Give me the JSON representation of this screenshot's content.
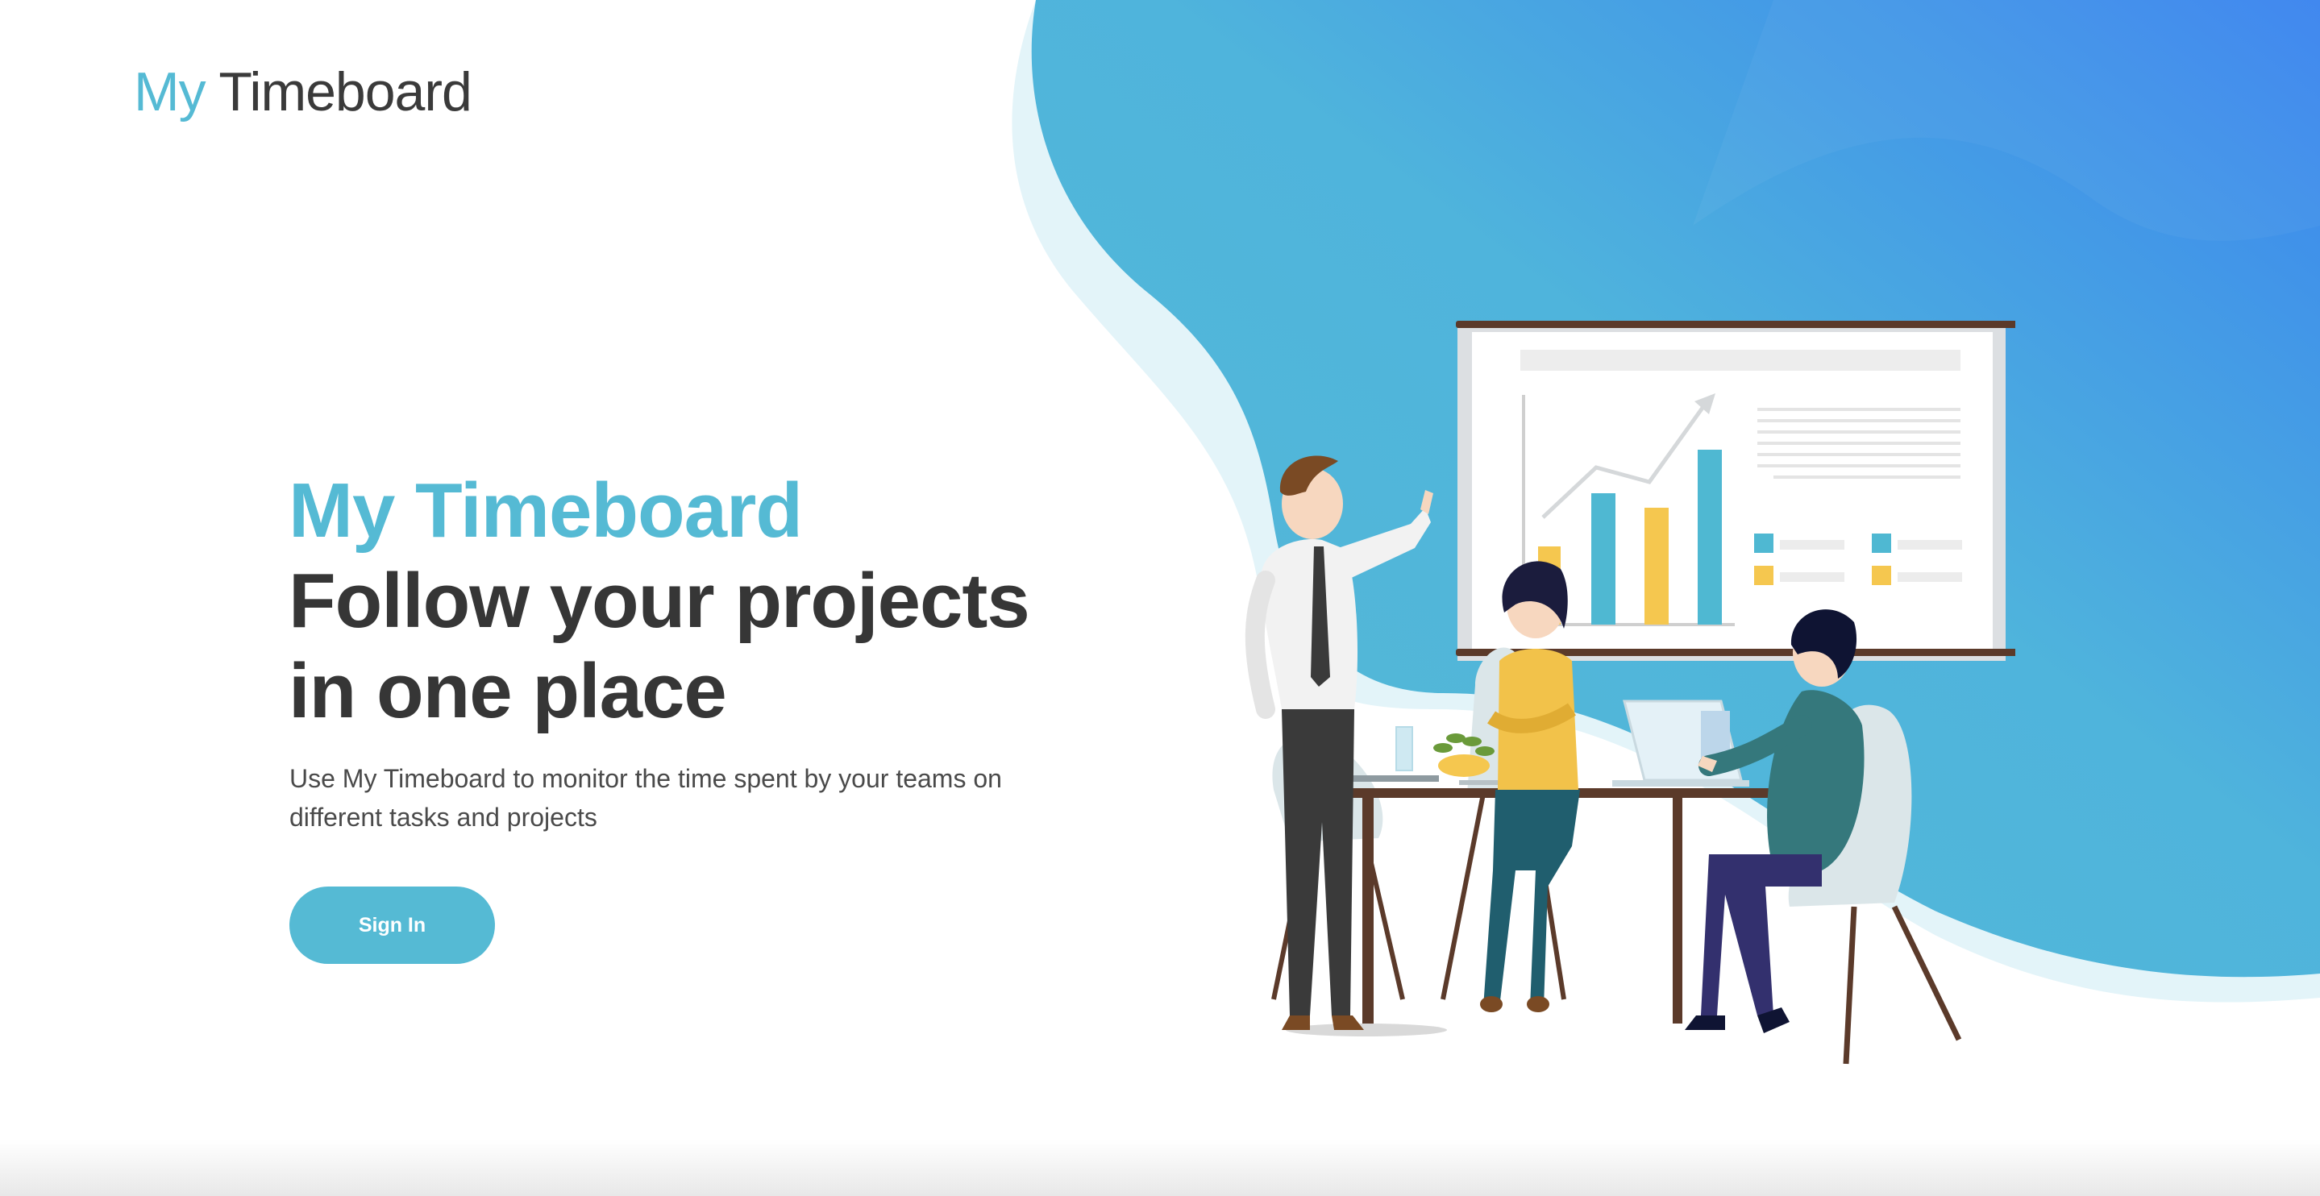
{
  "header": {
    "logo_accent": "My",
    "logo_rest": "Timeboard"
  },
  "hero": {
    "brand": "My Timeboard",
    "headline_line1": "Follow your projects",
    "headline_line2": "in one place",
    "description": "Use My Timeboard to monitor the time spent by your teams on different tasks and projects",
    "sign_in_label": "Sign In"
  },
  "colors": {
    "accent": "#55bad4",
    "text_dark": "#363636",
    "gradient_start": "#55bad4",
    "gradient_end": "#3b86ee",
    "board_bar_blue": "#4fb8d2",
    "board_bar_yellow": "#f5c74f"
  },
  "illustration": {
    "icon": "team-meeting-illustration"
  }
}
